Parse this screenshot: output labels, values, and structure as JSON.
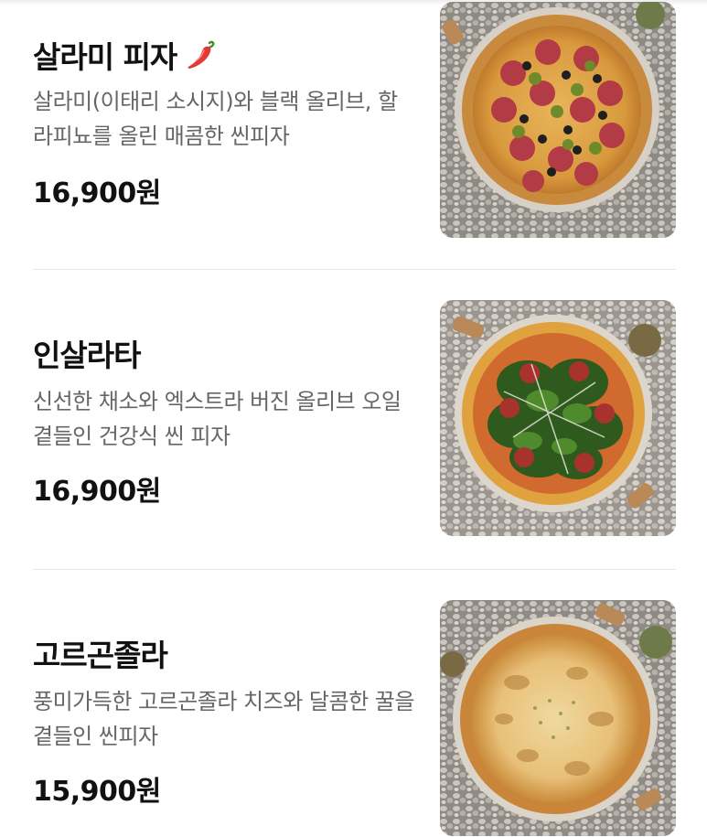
{
  "menu": {
    "items": [
      {
        "name": "살라미 피자",
        "spicy": true,
        "description": "살라미(이태리 소시지)와 블랙 올리브, 할라피뇨를 올린 매콤한 씬피자",
        "price": "16,900원",
        "photo_icon": "salami-pizza-photo"
      },
      {
        "name": "인살라타",
        "spicy": false,
        "description": "신선한 채소와 엑스트라 버진 올리브 오일 곁들인 건강식 씬 피자",
        "price": "16,900원",
        "photo_icon": "insalata-pizza-photo"
      },
      {
        "name": "고르곤졸라",
        "spicy": false,
        "description": "풍미가득한 고르곤졸라 치즈와 달콤한 꿀을 곁들인 씬피자",
        "price": "15,900원",
        "photo_icon": "gorgonzola-pizza-photo"
      }
    ]
  },
  "colors": {
    "title": "#111111",
    "description": "#666666",
    "price": "#111111",
    "divider": "#e6e6e6",
    "spicy_icon": "#e53935"
  }
}
